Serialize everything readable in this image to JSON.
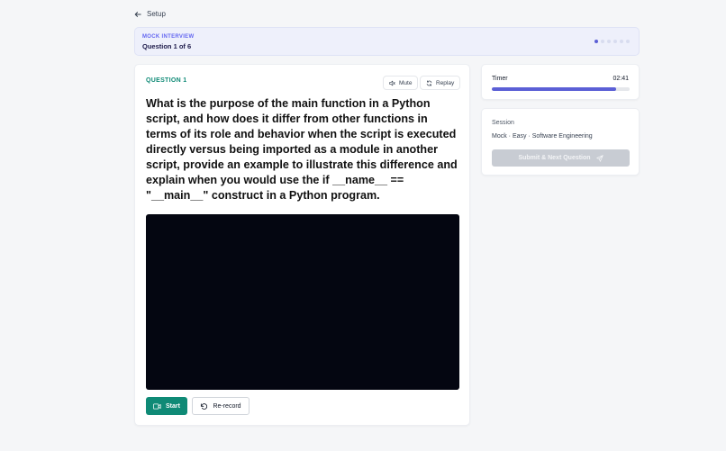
{
  "nav": {
    "back_label": "Setup"
  },
  "banner": {
    "kicker": "MOCK INTERVIEW",
    "question_count": "Question 1 of 6",
    "progress_dots": {
      "total": 6,
      "active_index": 0
    }
  },
  "question": {
    "label": "QUESTION 1",
    "mute_label": "Mute",
    "replay_label": "Replay",
    "text": "What is the purpose of the main function in a Python script, and how does it differ from other functions in terms of its role and behavior when the script is executed directly versus being imported as a module in another script, provide an example to illustrate this difference and explain when you would use the if __name__ == \"__main__\" construct in a Python program."
  },
  "recorder": {
    "start_label": "Start",
    "rerecord_label": "Re-record"
  },
  "timer": {
    "label": "Timer",
    "value": "02:41",
    "progress_fraction": 0.9
  },
  "session": {
    "label": "Session",
    "value": "Mock · Easy · Software Engineering",
    "submit_label": "Submit & Next Question"
  },
  "colors": {
    "accent": "#5b5fd6",
    "primary_green": "#0f8a76",
    "video_bg": "#040611"
  }
}
